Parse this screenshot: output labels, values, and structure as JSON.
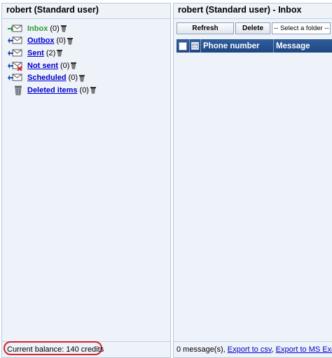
{
  "left_panel": {
    "title": "robert (Standard user)",
    "folders": [
      {
        "label": "Inbox",
        "count": "(0)",
        "icon": "inbox-icon",
        "active": true
      },
      {
        "label": "Outbox",
        "count": "(0)",
        "icon": "outbox-icon",
        "active": false
      },
      {
        "label": "Sent",
        "count": "(2)",
        "icon": "sent-icon",
        "active": false
      },
      {
        "label": "Not sent",
        "count": "(0)",
        "icon": "not-sent-icon",
        "active": false
      },
      {
        "label": "Scheduled",
        "count": "(0)",
        "icon": "scheduled-icon",
        "active": false
      },
      {
        "label": "Deleted items",
        "count": "(0)",
        "icon": "recycle-bin-icon",
        "active": false
      }
    ],
    "balance": "Current balance: 140 credits"
  },
  "right_panel": {
    "title": "robert (Standard user) - Inbox",
    "toolbar": {
      "refresh_label": "Refresh",
      "delete_label": "Delete",
      "folder_select_value": "-- Select a folder --"
    },
    "columns": {
      "phone": "Phone number",
      "message": "Message"
    },
    "status": {
      "message_count": "0 message(s),",
      "export_csv": "Export to csv",
      "separator": ",",
      "export_excel": "Export to MS Excel x"
    }
  },
  "colors": {
    "panel_bg": "#eef2f9",
    "header_blue": "#2f5f9c",
    "link_blue": "#0000cc",
    "active_green": "#2e9b2e",
    "highlight_red": "#d6242a"
  }
}
